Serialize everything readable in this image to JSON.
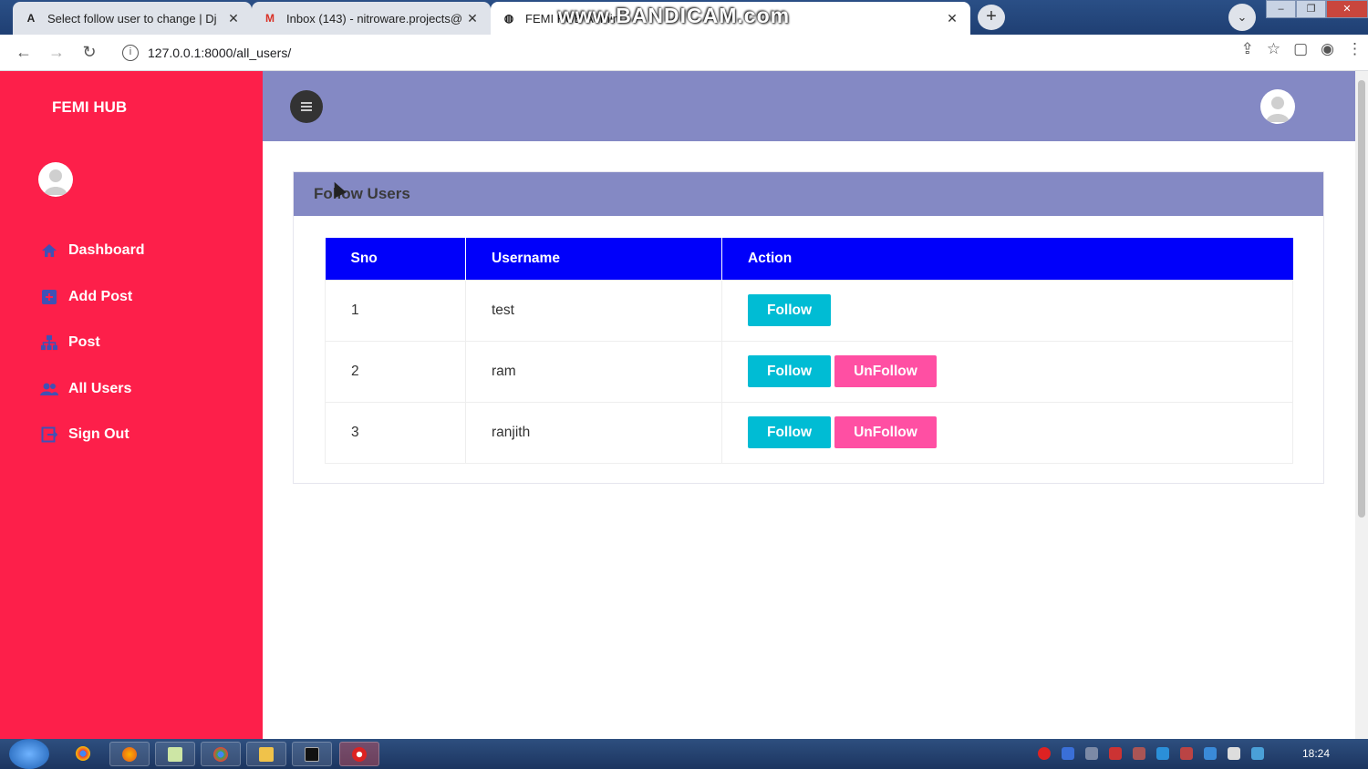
{
  "browser": {
    "tabs": [
      {
        "favicon": "A",
        "title": "Select follow user to change | Dj",
        "active": false
      },
      {
        "favicon": "M",
        "title": "Inbox (143) - nitroware.projects@",
        "active": false
      },
      {
        "favicon": "globe",
        "title": "FEMI HUB",
        "title_suffix": "Admin",
        "active": true
      }
    ],
    "new_tab": "+",
    "watermark": "www.BANDICAM.com",
    "url": "127.0.0.1:8000/all_users/"
  },
  "sidebar": {
    "brand": "FEMI HUB",
    "items": [
      {
        "label": "Dashboard",
        "icon": "home-icon",
        "color": "#3f51b5"
      },
      {
        "label": "Add Post",
        "icon": "add-box-icon",
        "color": "#3f51b5"
      },
      {
        "label": "Post",
        "icon": "sitemap-icon",
        "color": "#3f51b5"
      },
      {
        "label": "All Users",
        "icon": "users-icon",
        "color": "#3f51b5"
      },
      {
        "label": "Sign Out",
        "icon": "sign-out-icon",
        "color": "#3f51b5"
      }
    ]
  },
  "main": {
    "card_title": "Follow Users",
    "table": {
      "columns": [
        "Sno",
        "Username",
        "Action"
      ],
      "rows": [
        {
          "sno": "1",
          "username": "test",
          "actions": [
            "Follow"
          ]
        },
        {
          "sno": "2",
          "username": "ram",
          "actions": [
            "Follow",
            "UnFollow"
          ]
        },
        {
          "sno": "3",
          "username": "ranjith",
          "actions": [
            "Follow",
            "UnFollow"
          ]
        }
      ]
    }
  },
  "taskbar": {
    "clock": "18:24"
  },
  "colors": {
    "sidebar": "#fd1f4a",
    "topbar": "#8489c4",
    "table_header": "#0000fa",
    "follow": "#00bcd4",
    "unfollow": "#ff4fa3"
  }
}
